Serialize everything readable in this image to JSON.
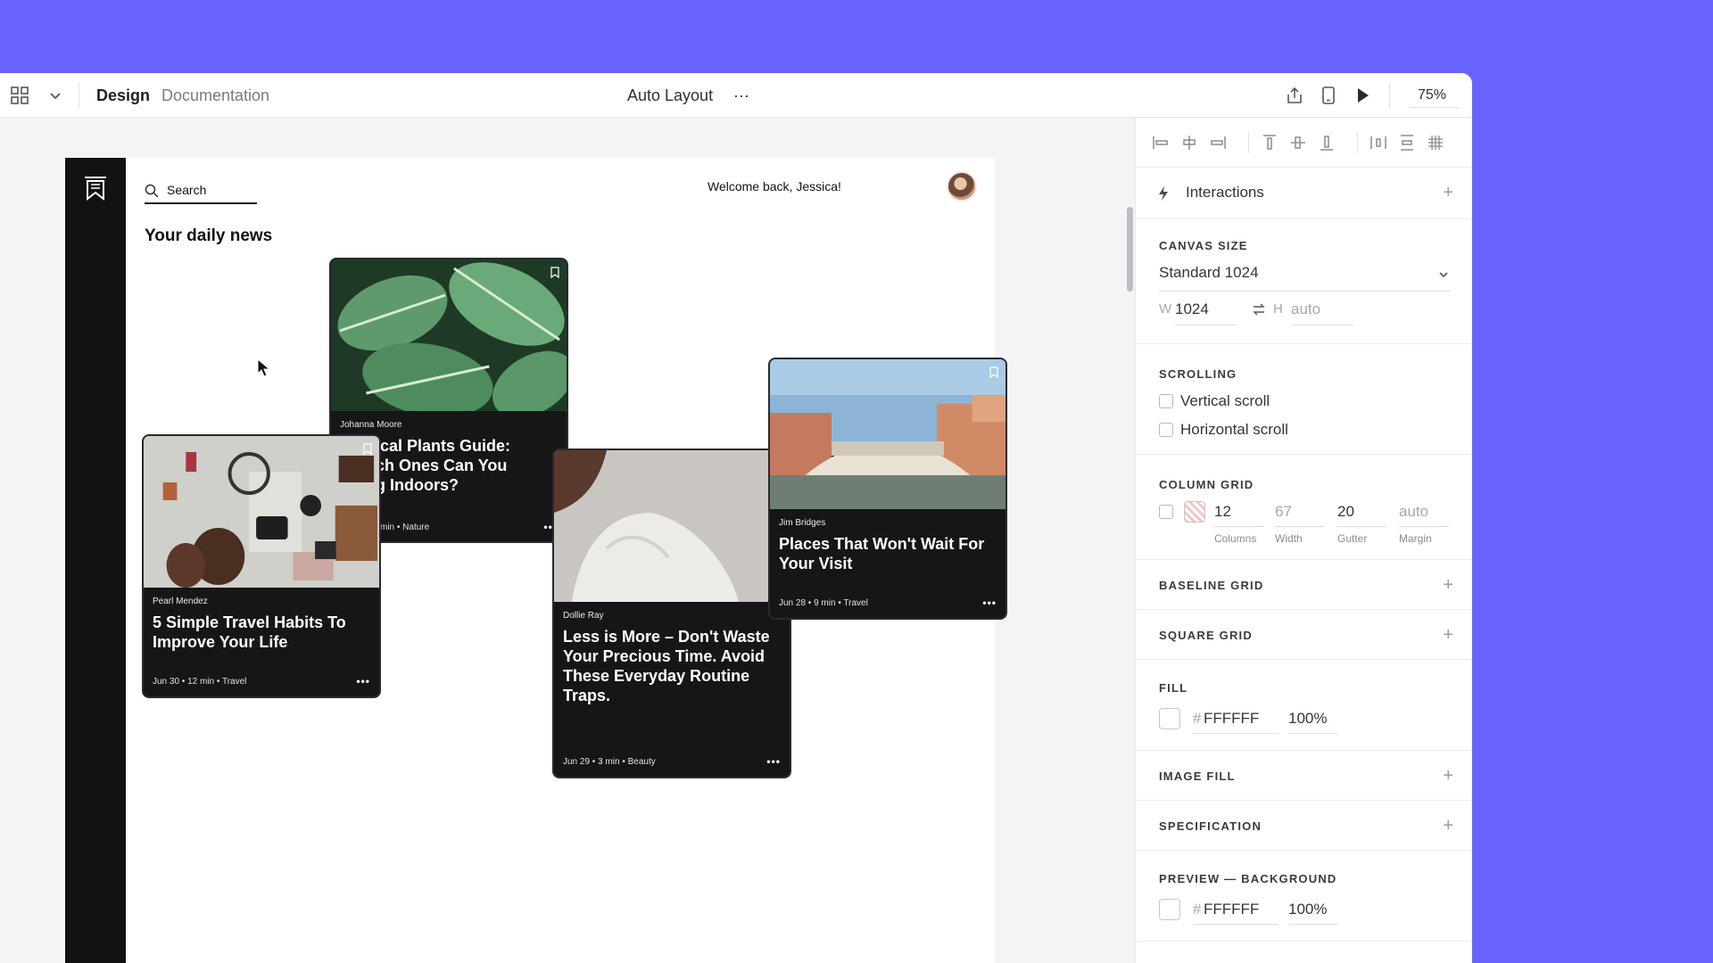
{
  "toolbar": {
    "tab_design": "Design",
    "tab_documentation": "Documentation",
    "doc_title": "Auto Layout",
    "more": "···",
    "zoom": "75%"
  },
  "frame": {
    "search_placeholder": "Search",
    "welcome": "Welcome back, Jessica!",
    "heading": "Your daily news"
  },
  "cards": [
    {
      "author": "Johanna Moore",
      "title_visible": "ical Plants Guide:\nch Ones Can You\ng Indoors?",
      "meta": "min • Nature",
      "dots": "•••"
    },
    {
      "author": "Pearl Mendez",
      "title": "5 Simple Travel Habits To Improve Your Life",
      "meta": "Jun 30 • 12 min • Travel",
      "dots": "•••"
    },
    {
      "author": "Dollie Ray",
      "title": "Less is More – Don't Waste Your Precious Time. Avoid These Everyday Routine Traps.",
      "meta": "Jun 29 • 3 min • Beauty",
      "dots": "•••"
    },
    {
      "author": "Jim Bridges",
      "title": "Places That Won't Wait For Your Visit",
      "meta": "Jun 28 • 9 min • Travel",
      "dots": "•••"
    }
  ],
  "panel": {
    "interactions": "Interactions",
    "canvas_size": {
      "label": "CANVAS SIZE",
      "preset": "Standard 1024",
      "w_label": "W",
      "w_value": "1024",
      "h_label": "H",
      "h_value": "auto"
    },
    "scrolling": {
      "label": "SCROLLING",
      "vertical": "Vertical scroll",
      "horizontal": "Horizontal scroll"
    },
    "column_grid": {
      "label": "COLUMN GRID",
      "columns": "12",
      "width": "67",
      "gutter": "20",
      "margin": "auto",
      "columns_lbl": "Columns",
      "width_lbl": "Width",
      "gutter_lbl": "Gutter",
      "margin_lbl": "Margin"
    },
    "baseline_grid": "BASELINE GRID",
    "square_grid": "SQUARE GRID",
    "fill": {
      "label": "FILL",
      "hash": "#",
      "hex": "FFFFFF",
      "opacity": "100%"
    },
    "image_fill": "IMAGE FILL",
    "specification": "SPECIFICATION",
    "preview_bg": {
      "label": "PREVIEW — BACKGROUND",
      "hash": "#",
      "hex": "FFFFFF",
      "opacity": "100%"
    },
    "plus": "+"
  },
  "colors": {
    "background": "#6964FF",
    "panel": "#FFFFFF",
    "canvas": "#F4F4F6",
    "card": "#161618"
  },
  "icons": [
    "grid-icon",
    "chevron-down-icon",
    "export-icon",
    "device-icon",
    "play-icon",
    "bolt-icon",
    "align-left-icon",
    "align-center-h-icon",
    "align-right-icon",
    "align-top-icon",
    "align-middle-v-icon",
    "align-bottom-icon",
    "distribute-h-icon",
    "distribute-v-icon",
    "grid-hash-icon",
    "search-icon",
    "bookmark-icon",
    "swap-icon"
  ]
}
